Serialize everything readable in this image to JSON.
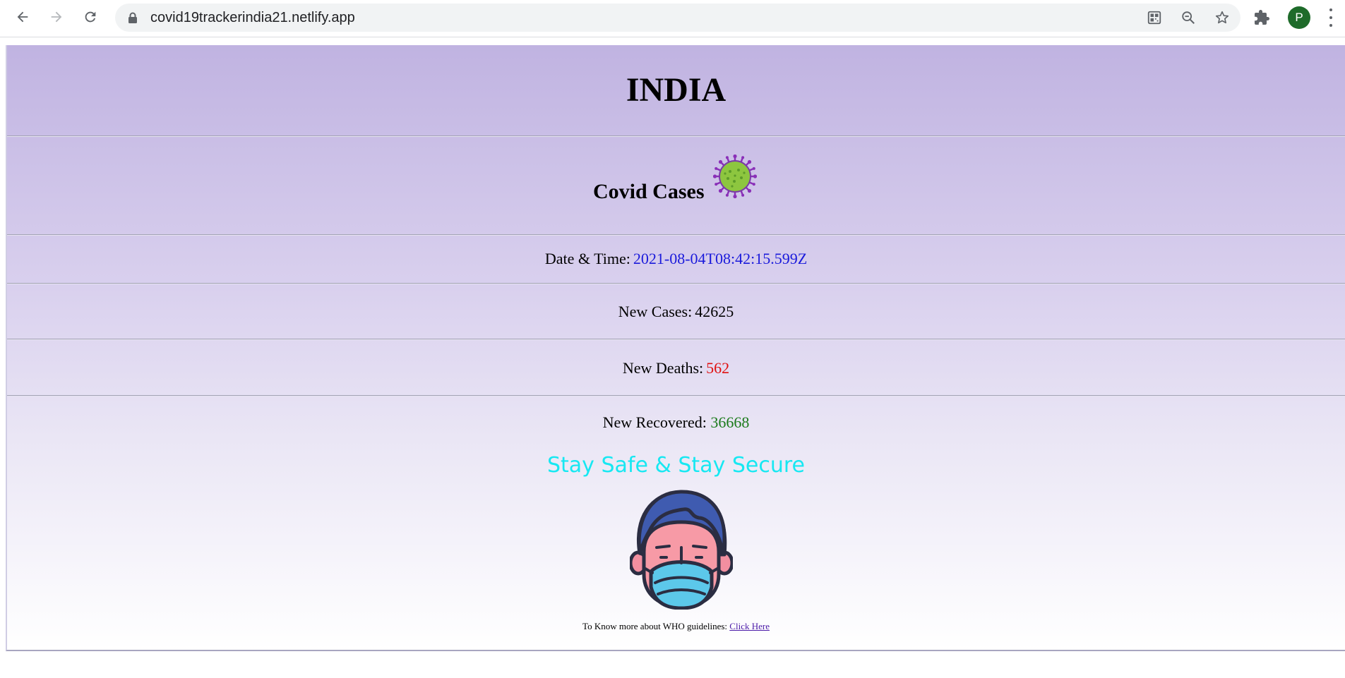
{
  "browser": {
    "url": "covid19trackerindia21.netlify.app",
    "avatar_letter": "P",
    "icons": [
      "back-icon",
      "forward-icon",
      "reload-icon",
      "lock-icon",
      "qr-code-icon",
      "zoom-out-icon",
      "star-icon",
      "extensions-puzzle-icon",
      "menu-dots-icon"
    ]
  },
  "page": {
    "title": "INDIA",
    "covid_cases_label": "Covid Cases",
    "date_label": "Date & Time:",
    "date_value": "2021-08-04T08:42:15.599Z",
    "new_cases_label": "New Cases:",
    "new_cases_value": "42625",
    "new_deaths_label": "New Deaths:",
    "new_deaths_value": "562",
    "new_recovered_label": "New Recovered:",
    "new_recovered_value": "36668",
    "slogan": "Stay Safe & Stay Secure",
    "who_text": "To Know more about WHO guidelines:",
    "who_link": "Click Here"
  },
  "colors": {
    "header_bg": "#c0b3e1",
    "date_value": "#1a1adb",
    "deaths_value": "#e01010",
    "recovered_value": "#1b7a1b",
    "slogan": "#17e8f2",
    "link": "#4b1aa8"
  }
}
